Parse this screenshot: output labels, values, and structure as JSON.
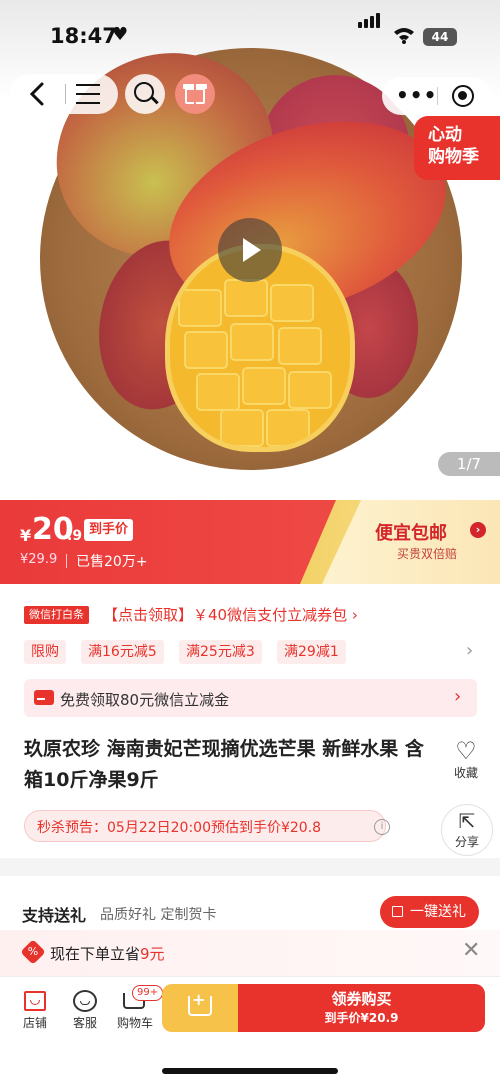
{
  "status_bar": {
    "time": "18:47",
    "battery": "44"
  },
  "promo_badge": {
    "line1": "心动",
    "line2": "购物季"
  },
  "gallery": {
    "pager": "1/7"
  },
  "price": {
    "yen": "¥",
    "integer": "20",
    "decimal": ".9",
    "tag": "到手价",
    "original": "¥29.9",
    "sold": "已售20万+",
    "free_shipping_title": "便宜包邮",
    "free_shipping_sub": "买贵双倍赔",
    "arrow": "›"
  },
  "coupons": {
    "wx_tag": "微信打白条",
    "wx_text": "【点击领取】￥40微信支付立减券包 ›",
    "chips": [
      "限购",
      "满16元减5",
      "满25元减3",
      "满29减1"
    ],
    "subsidy_text": "免费领取80元微信立减金"
  },
  "product": {
    "title": "玖原农珍 海南贵妃芒现摘优选芒果 新鲜水果 含箱10斤净果9斤",
    "favorite_label": "收藏",
    "share_label": "分享",
    "flash_notice": "秒杀预告：05月22日20:00预估到手价¥20.8"
  },
  "gift": {
    "heading": "支持送礼",
    "sub": "品质好礼 定制贺卡",
    "button": "一键送礼"
  },
  "toast": {
    "text": "现在下单立省",
    "amount": "9元"
  },
  "tabbar": {
    "store": "店铺",
    "service": "客服",
    "cart": "购物车",
    "cart_badge": "99+",
    "buy_main": "领券购买",
    "buy_sub": "到手价¥20.9"
  },
  "colors": {
    "accent": "#e8322c",
    "gold": "#f6c24a"
  }
}
